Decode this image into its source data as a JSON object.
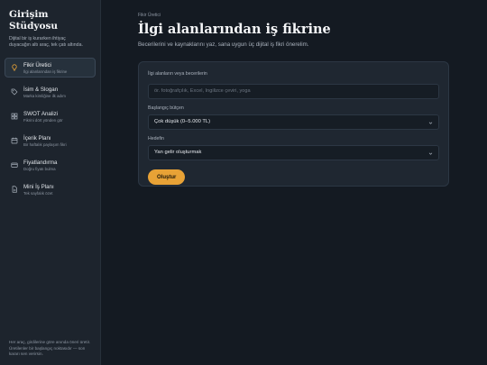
{
  "sidebar": {
    "brand_title": "Girişim Stüdyosu",
    "brand_desc": "Dijital bir iş kurarken ihtiyaç duyacağın altı araç, tek çatı altında.",
    "items": [
      {
        "label": "Fikir Üretici",
        "sub": "İlgi alanlarından iş fikrine",
        "icon": "bulb-icon",
        "active": true
      },
      {
        "label": "İsim & Slogan",
        "sub": "Marka kimliğine ilk adım",
        "icon": "tag-icon",
        "active": false
      },
      {
        "label": "SWOT Analizi",
        "sub": "Fikrini dört yönden gör",
        "icon": "grid-icon",
        "active": false
      },
      {
        "label": "İçerik Planı",
        "sub": "Bir haftalık paylaşım fikri",
        "icon": "calendar-icon",
        "active": false
      },
      {
        "label": "Fiyatlandırma",
        "sub": "Doğru fiyatı bulma",
        "icon": "wallet-icon",
        "active": false
      },
      {
        "label": "Mini İş Planı",
        "sub": "Tek sayfalık özet",
        "icon": "document-icon",
        "active": false
      }
    ],
    "footer": "Her araç, girdilerine göre anında öneri üretir. Üretilenler bir başlangıç noktasıdır — son kararı sen verirsin."
  },
  "main": {
    "eyebrow": "Fikir Üretici",
    "title": "İlgi alanlarından iş fikrine",
    "subtitle": "Becerilerini ve kaynaklarını yaz, sana uygun üç dijital iş fikri önerelim.",
    "form": {
      "interests_label": "İlgi alanların veya becerilerin",
      "interests_placeholder": "ör. fotoğrafçılık, Excel, İngilizce çeviri, yoga",
      "interests_value": "",
      "budget_label": "Başlangıç bütçen",
      "budget_value": "Çok düşük (0–5.000 TL)",
      "goal_label": "Hedefin",
      "goal_value": "Yan gelir oluşturmak",
      "submit_label": "Oluştur"
    }
  },
  "colors": {
    "accent": "#e8a236",
    "active_icon": "#e8a236",
    "background": "#141a22",
    "sidebar": "#1d242d",
    "card": "#1f2731"
  }
}
